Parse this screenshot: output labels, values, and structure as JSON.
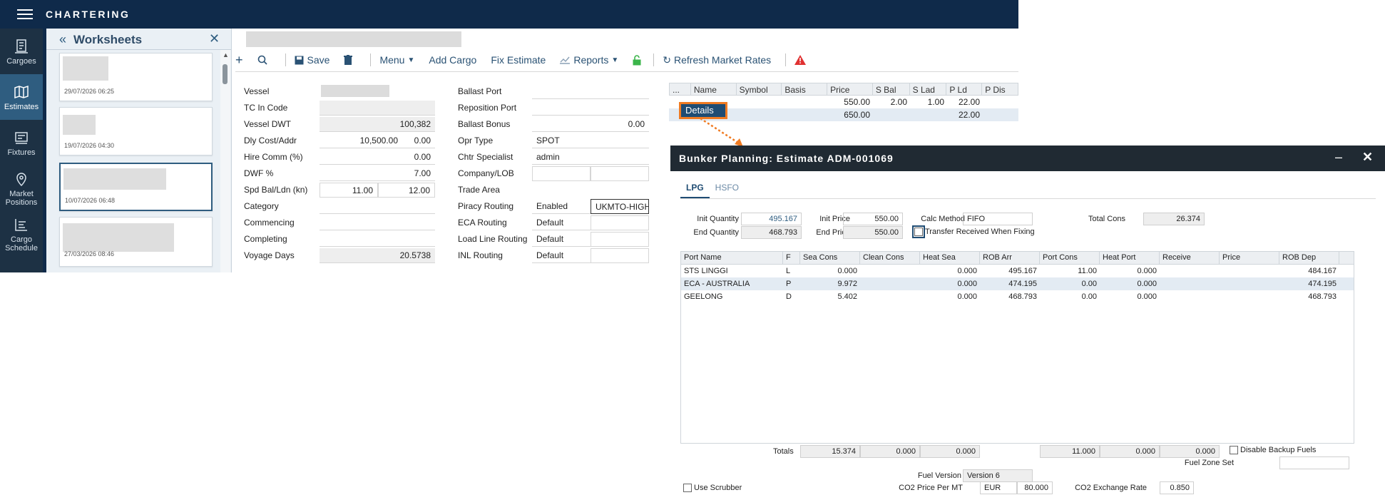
{
  "app": {
    "title": "CHARTERING"
  },
  "leftnav": [
    {
      "label": "Cargoes",
      "icon": "cargoes-icon"
    },
    {
      "label": "Estimates",
      "icon": "map-icon",
      "active": true
    },
    {
      "label": "Fixtures",
      "icon": "fixtures-icon"
    },
    {
      "label": "Market Positions",
      "icon": "location-pin-icon"
    },
    {
      "label": "Cargo Schedule",
      "icon": "schedule-icon"
    }
  ],
  "worksheets": {
    "title": "Worksheets",
    "cards": [
      {
        "date": "29/07/2026 06:25"
      },
      {
        "date": "19/07/2026 04:30"
      },
      {
        "date": "10/07/2026 06:48",
        "selected": true
      },
      {
        "date": "27/03/2026 08:46"
      }
    ]
  },
  "toolbar": {
    "save": "Save",
    "menu": "Menu",
    "add_cargo": "Add Cargo",
    "fix_estimate": "Fix Estimate",
    "reports": "Reports",
    "refresh": "Refresh Market Rates"
  },
  "form_left": {
    "vessel": "Vessel",
    "tc_in_code": "TC In Code",
    "vessel_dwt": "Vessel DWT",
    "vessel_dwt_val": "100,382",
    "dly_cost": "Dly Cost/Addr",
    "dly_cost_val": "10,500.00",
    "dly_addr_val": "0.00",
    "hire_comm": "Hire Comm (%)",
    "hire_comm_val": "0.00",
    "dwf": "DWF %",
    "dwf_val": "7.00",
    "spd": "Spd Bal/Ldn (kn)",
    "spd_bal": "11.00",
    "spd_ldn": "12.00",
    "category": "Category",
    "commencing": "Commencing",
    "completing": "Completing",
    "voyage_days": "Voyage Days",
    "voyage_days_val": "20.5738"
  },
  "form_right": {
    "ballast_port": "Ballast Port",
    "reposition_port": "Reposition Port",
    "ballast_bonus": "Ballast Bonus",
    "ballast_bonus_val": "0.00",
    "opr_type": "Opr Type",
    "opr_type_val": "SPOT",
    "chtr_specialist": "Chtr Specialist",
    "chtr_specialist_val": "admin",
    "company_lob": "Company/LOB",
    "trade_area": "Trade Area",
    "piracy_routing": "Piracy Routing",
    "piracy_routing_val": "Enabled",
    "piracy_routing_val2": "UKMTO-HIGH",
    "eca_routing": "ECA Routing",
    "eca_routing_val": "Default",
    "load_line": "Load Line Routing",
    "load_line_val": "Default",
    "inl_routing": "INL Routing",
    "inl_routing_val": "Default"
  },
  "price_grid": {
    "headers": [
      "...",
      "Name",
      "Symbol",
      "Basis",
      "Price",
      "S Bal",
      "S Lad",
      "P Ld",
      "P Dis"
    ],
    "rows": [
      [
        "",
        "",
        "",
        "",
        "550.00",
        "2.00",
        "1.00",
        "22.00",
        ""
      ],
      [
        "",
        "",
        "",
        "",
        "650.00",
        "",
        "",
        "22.00",
        ""
      ]
    ]
  },
  "details_button": "Details",
  "bunker": {
    "title": "Bunker Planning: Estimate ADM-001069",
    "tabs": [
      "LPG",
      "HSFO"
    ],
    "init_quantity_label": "Init Quantity",
    "init_quantity": "495.167",
    "end_quantity_label": "End Quantity",
    "end_quantity": "468.793",
    "init_price_label": "Init Price",
    "init_price": "550.00",
    "end_price_label": "End Price",
    "end_price": "550.00",
    "calc_method_label": "Calc Method",
    "calc_method": "FIFO",
    "transfer_label": "Transfer Received When Fixing",
    "total_cons_label": "Total Cons",
    "total_cons": "26.374",
    "grid_headers": [
      "Port Name",
      "F",
      "Sea Cons",
      "Clean Cons",
      "Heat Sea",
      "ROB Arr",
      "Port Cons",
      "Heat Port",
      "Receive",
      "Price",
      "ROB Dep"
    ],
    "grid_rows": [
      [
        "STS LINGGI",
        "L",
        "0.000",
        "",
        "0.000",
        "495.167",
        "11.00",
        "0.000",
        "",
        "",
        "484.167"
      ],
      [
        "ECA - AUSTRALIA",
        "P",
        "9.972",
        "",
        "0.000",
        "474.195",
        "0.00",
        "0.000",
        "",
        "",
        "474.195"
      ],
      [
        "GEELONG",
        "D",
        "5.402",
        "",
        "0.000",
        "468.793",
        "0.00",
        "0.000",
        "",
        "",
        "468.793"
      ]
    ],
    "totals_label": "Totals",
    "totals": [
      "15.374",
      "0.000",
      "0.000",
      "11.000",
      "0.000",
      "0.000"
    ],
    "disable_backup": "Disable Backup Fuels",
    "fuel_zone_set": "Fuel Zone Set",
    "fuel_version_label": "Fuel Version",
    "fuel_version": "Version 6",
    "use_scrubber": "Use Scrubber",
    "co2_price_label": "CO2 Price Per MT",
    "co2_currency": "EUR",
    "co2_price": "80.000",
    "co2_rate_label": "CO2 Exchange Rate",
    "co2_rate": "0.850"
  }
}
